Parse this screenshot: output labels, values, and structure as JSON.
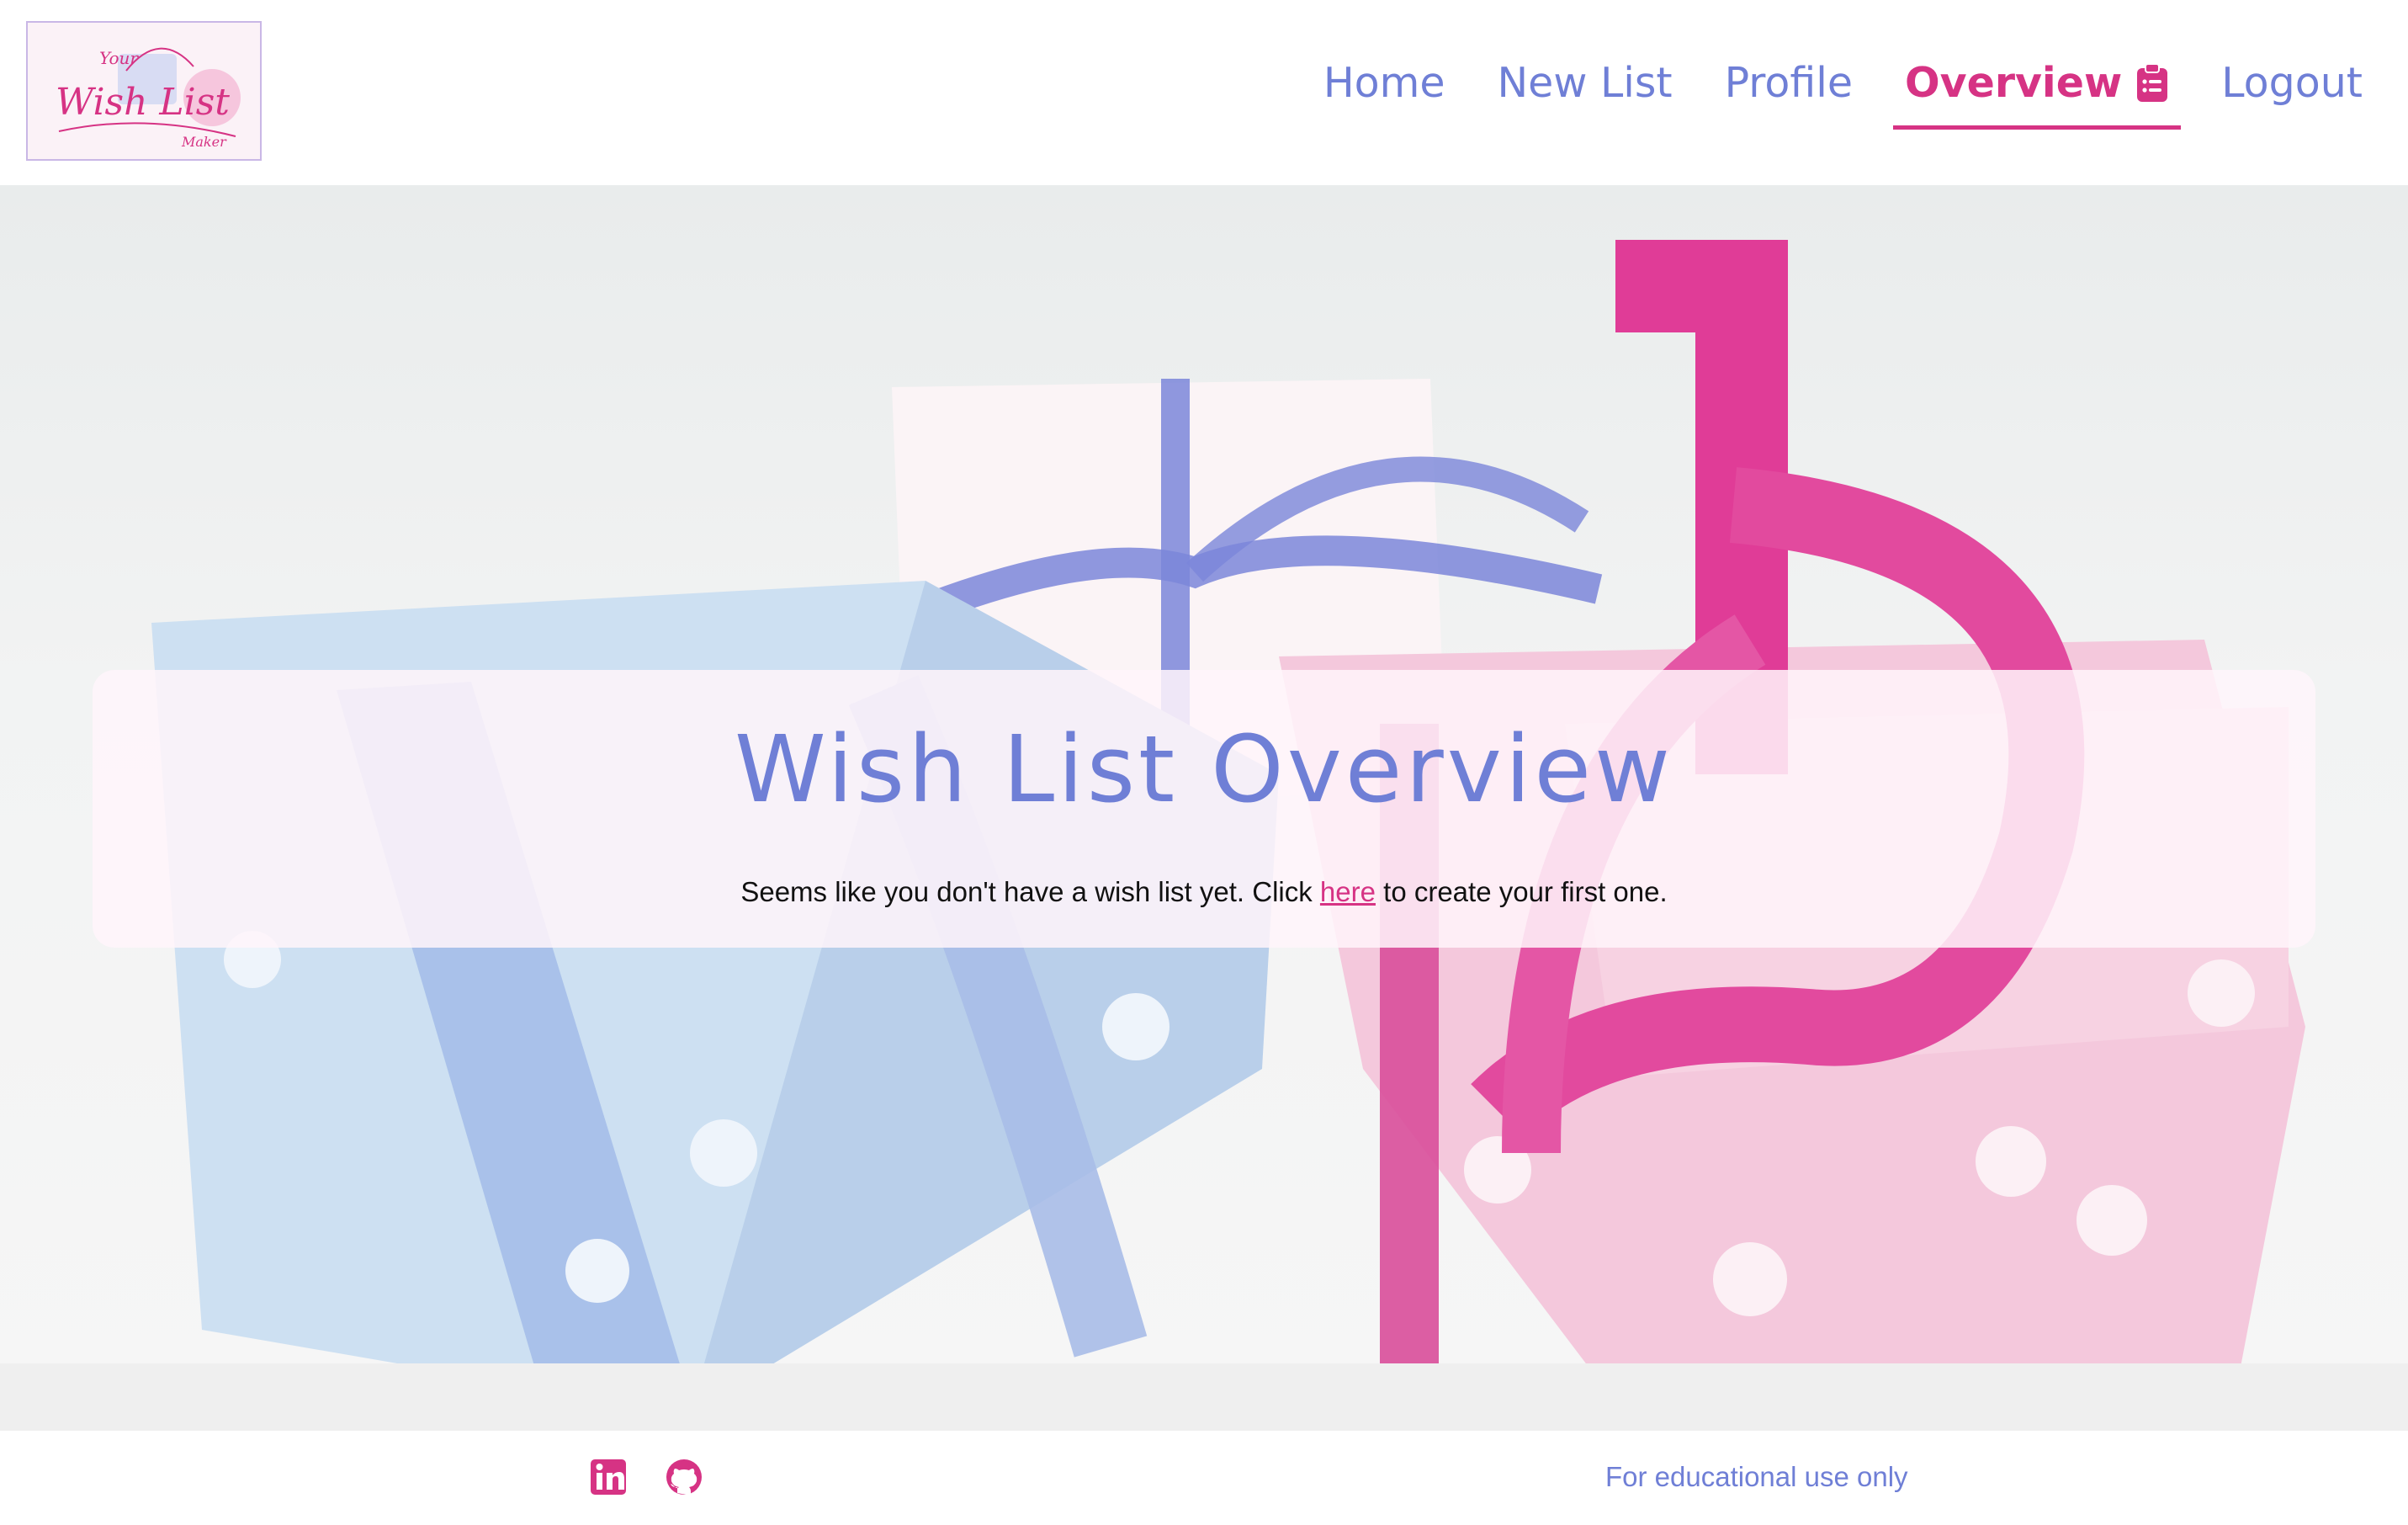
{
  "brand": {
    "logo_icon": "gift-wish-list-logo",
    "logo_top": "Your",
    "logo_main": "Wish List",
    "logo_bottom": "Maker"
  },
  "nav": {
    "items": [
      {
        "label": "Home"
      },
      {
        "label": "New List"
      },
      {
        "label": "Profile"
      },
      {
        "label": "Overview",
        "icon": "clipboard-list-icon",
        "active": true
      },
      {
        "label": "Logout"
      }
    ]
  },
  "overview": {
    "title": "Wish List Overview",
    "message_before": "Seems like you don't have a wish list yet. Click ",
    "link_text": "here",
    "message_after": " to create your first one."
  },
  "footer": {
    "social": [
      {
        "icon": "linkedin-icon"
      },
      {
        "icon": "github-icon"
      }
    ],
    "note": "For educational use only"
  },
  "colors": {
    "brand_blue": "#6f7fd6",
    "brand_pink": "#d63384"
  }
}
